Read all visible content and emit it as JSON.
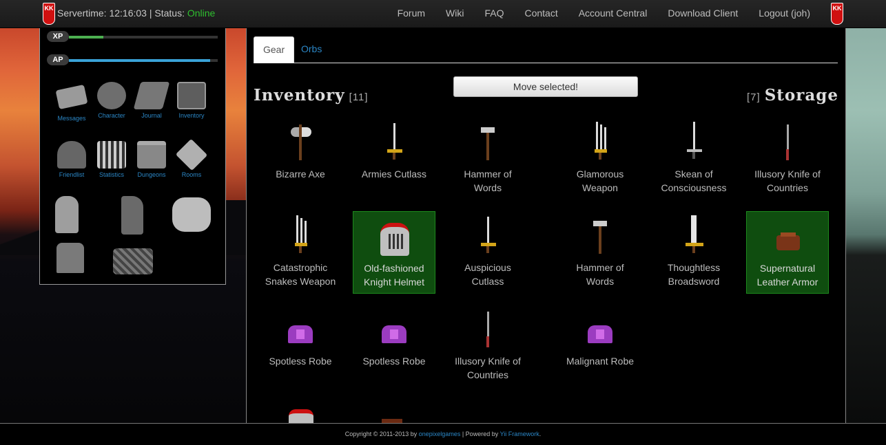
{
  "header": {
    "servertime_label": "Servertime: 12:16:03 | Status:",
    "status": "Online",
    "nav": [
      "Forum",
      "Wiki",
      "FAQ",
      "Contact",
      "Account Central",
      "Download Client",
      "Logout (joh)"
    ],
    "logo_text": "KK"
  },
  "sidebar": {
    "xp_label": "XP",
    "ap_label": "AP",
    "xp_fraction": 0.23,
    "ap_fraction": 0.95,
    "tiles": [
      "Messages",
      "Character",
      "Journal",
      "Inventory",
      "Friendlist",
      "Statistics",
      "Dungeons",
      "Rooms"
    ]
  },
  "tabs": [
    "Gear",
    "Orbs"
  ],
  "move_button": "Move selected!",
  "inventory": {
    "title": "Inventory",
    "count": "[11]"
  },
  "storage": {
    "title": "Storage",
    "count": "[7]"
  },
  "items": [
    {
      "name": "Bizarre Axe",
      "icon": "axe-icon",
      "selected": false
    },
    {
      "name": "Armies Cutlass",
      "icon": "cutlass-icon",
      "selected": false
    },
    {
      "name": "Hammer of Words",
      "icon": "hammer-icon",
      "selected": false
    },
    {
      "name": "Glamorous Weapon",
      "icon": "claw-weapon-icon",
      "selected": false
    },
    {
      "name": "Skean of Consciousness",
      "icon": "sword-icon",
      "selected": false
    },
    {
      "name": "Illusory Knife of Countries",
      "icon": "knife-icon",
      "selected": false
    },
    {
      "name": "Catastrophic Snakes Weapon",
      "icon": "claw-weapon-icon",
      "selected": false
    },
    {
      "name": "Old-fashioned Knight Helmet",
      "icon": "knight-helmet-icon",
      "selected": true
    },
    {
      "name": "Auspicious Cutlass",
      "icon": "cutlass-icon",
      "selected": false
    },
    {
      "name": "Hammer of Words",
      "icon": "hammer-icon",
      "selected": false
    },
    {
      "name": "Thoughtless Broadsword",
      "icon": "broadsword-icon",
      "selected": false
    },
    {
      "name": "Supernatural Leather Armor",
      "icon": "leather-armor-icon",
      "selected": true
    },
    {
      "name": "Spotless Robe",
      "icon": "robe-icon",
      "selected": false
    },
    {
      "name": "Spotless Robe",
      "icon": "robe-icon",
      "selected": false
    },
    {
      "name": "Illusory Knife of Countries",
      "icon": "knife-icon",
      "selected": false
    },
    {
      "name": "Malignant Robe",
      "icon": "robe-icon",
      "selected": false
    }
  ],
  "footer": {
    "prefix": "Copyright © 2011-2013 by",
    "company": "onepixelgames",
    "middle": "| Powered by",
    "framework": "Yii Framework",
    "suffix": "."
  },
  "colors": {
    "online": "#2fbf2f",
    "link": "#2b86c5",
    "selected_bg": "#0f4d0f",
    "xp": "#4caf50",
    "ap": "#3aa3d8"
  }
}
